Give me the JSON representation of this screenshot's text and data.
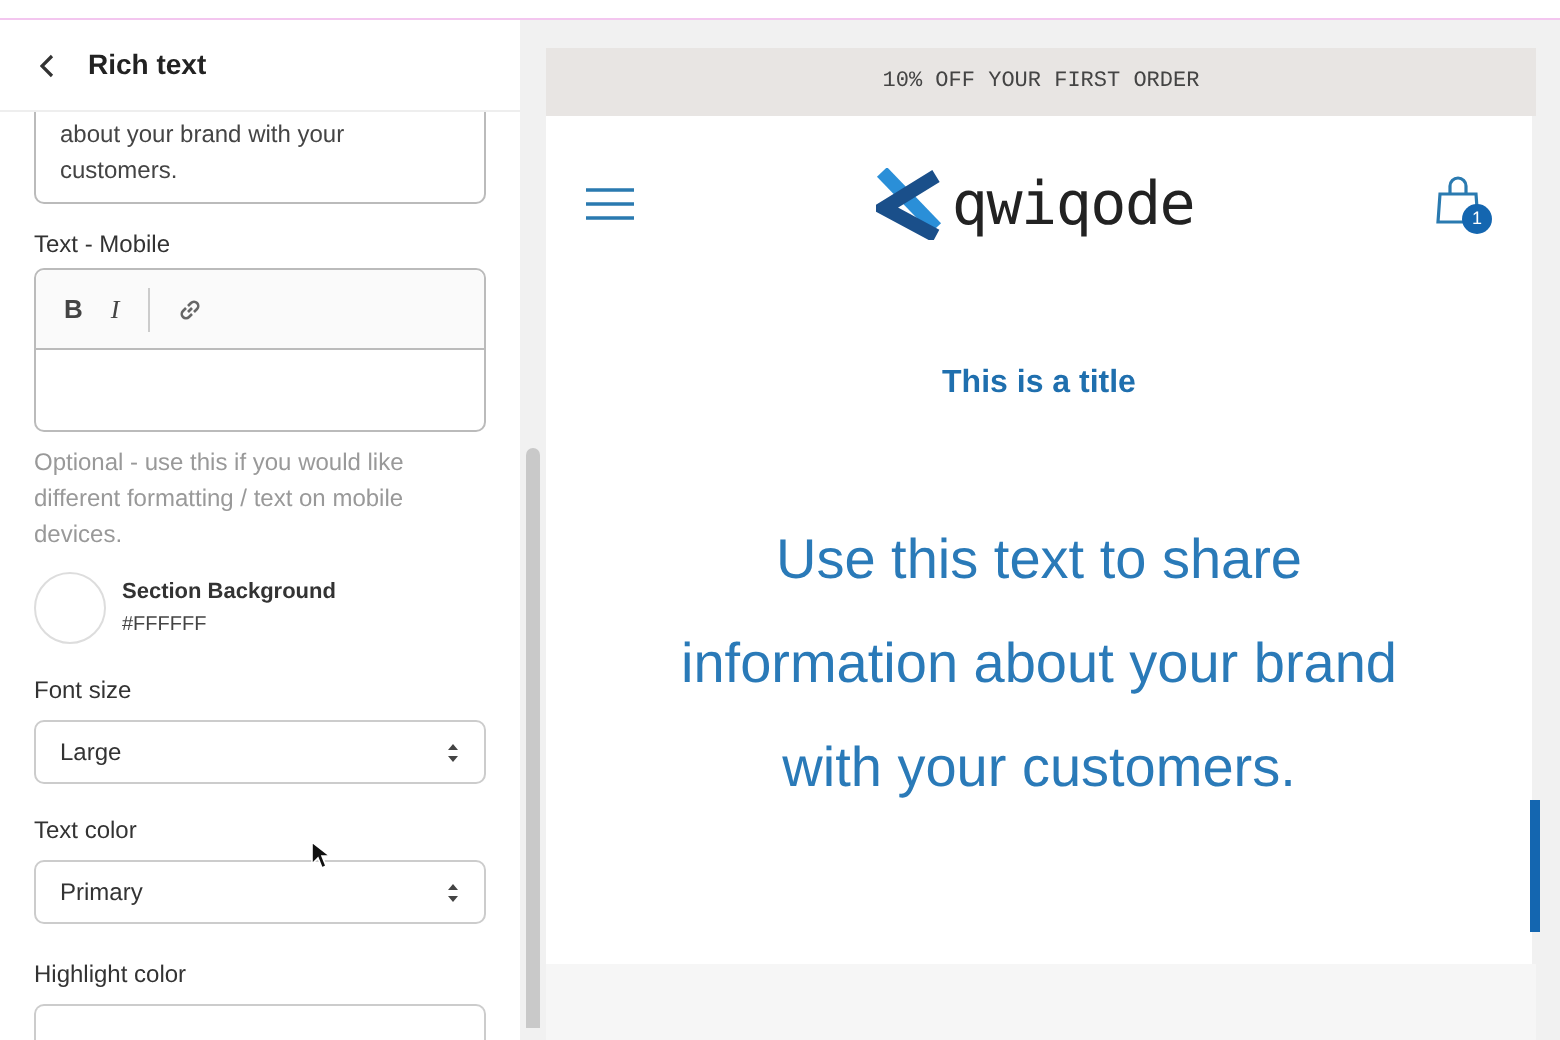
{
  "panel": {
    "title": "Rich text",
    "text_field": {
      "value_visible": "about your brand with your customers."
    },
    "mobile_text": {
      "label": "Text - Mobile",
      "toolbar": [
        "B",
        "I"
      ],
      "help": "Optional - use this if you would like different formatting / text on mobile devices."
    },
    "background": {
      "label": "Section Background",
      "value": "#FFFFFF",
      "color": "#ffffff"
    },
    "selects": [
      {
        "label": "Font size",
        "value": "Large"
      },
      {
        "label": "Text color",
        "value": "Primary"
      }
    ],
    "highlight": {
      "label": "Highlight color"
    }
  },
  "preview": {
    "announcement": "10% OFF YOUR FIRST ORDER",
    "logo": "qwiqode",
    "cart_count": "1",
    "title": "This is a title",
    "body": "Use this text to share information about your brand with your customers."
  }
}
